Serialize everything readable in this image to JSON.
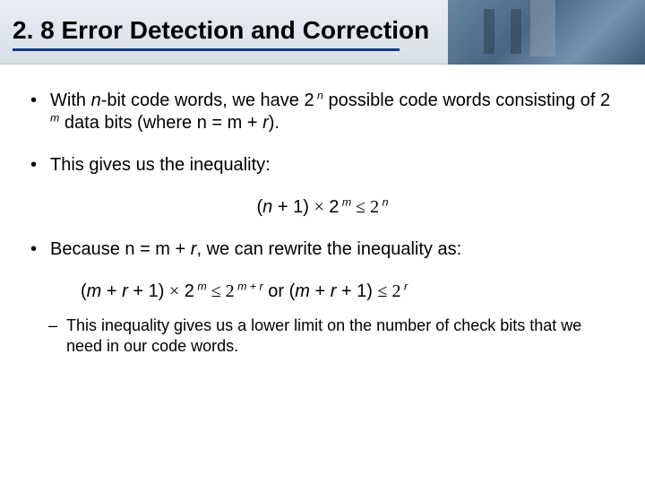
{
  "title": "2. 8 Error Detection and Correction",
  "bullets": {
    "b1_pre": "With ",
    "b1_n": "n",
    "b1_mid1": "-bit code words, we have 2",
    "b1_exp1": " n",
    "b1_mid2": " possible code words consisting of 2",
    "b1_exp2": " m",
    "b1_mid3": " data bits (where n = m + ",
    "b1_r": "r",
    "b1_end": ").",
    "b2": "This gives us the inequality:",
    "b3_pre": "Because n = m + ",
    "b3_r": "r",
    "b3_end": ", we can rewrite the inequality as:",
    "sub": "This inequality gives us a lower limit on the number of check bits that we need in our code words."
  },
  "formula1": {
    "p1": "(",
    "n": "n",
    "p2": " + 1) ",
    "times": "×",
    "p3": " 2",
    "exp_m": " m",
    "le": " ≤  2",
    "exp_n": " n"
  },
  "formula2": {
    "p1": "(",
    "m": "m",
    "p2": " + ",
    "r": "r",
    "p3": " + 1) ",
    "times": "×",
    "p4": " 2",
    "exp_m": " m",
    "le1": " ≤  2",
    "exp_mr": " m + r",
    "or": "  or   (",
    "m2": "m",
    "p5": " + ",
    "r2": "r",
    "p6": " + 1) ",
    "le2": "≤  2",
    "exp_r": " r"
  }
}
